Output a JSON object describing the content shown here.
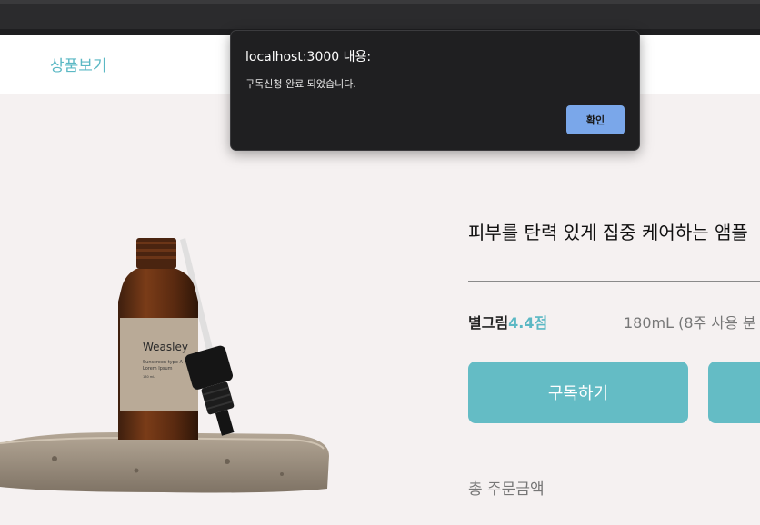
{
  "nav": {
    "link_label": "상품보기"
  },
  "product": {
    "image": {
      "brand_text": "Weasley",
      "label_line1": "Sunscreen type A",
      "label_line2": "Lorem Ipsum",
      "label_line3": "180 mL"
    },
    "title": "피부를 탄력 있게 집중 케어하는 앰플",
    "rating_label": "별그림",
    "rating_score": "4.4점",
    "volume": "180mL (8주 사용 분",
    "subscribe_label": "구독하기",
    "total_label": "총 주문금액"
  },
  "dialog": {
    "title": "localhost:3000 내용:",
    "message": "구독신청 완료 되었습니다.",
    "ok_label": "확인"
  },
  "colors": {
    "accent": "#5bb8c4",
    "button": "#64bcc5",
    "dialog_button": "#7aa7ea",
    "background": "#f5f1f1"
  }
}
